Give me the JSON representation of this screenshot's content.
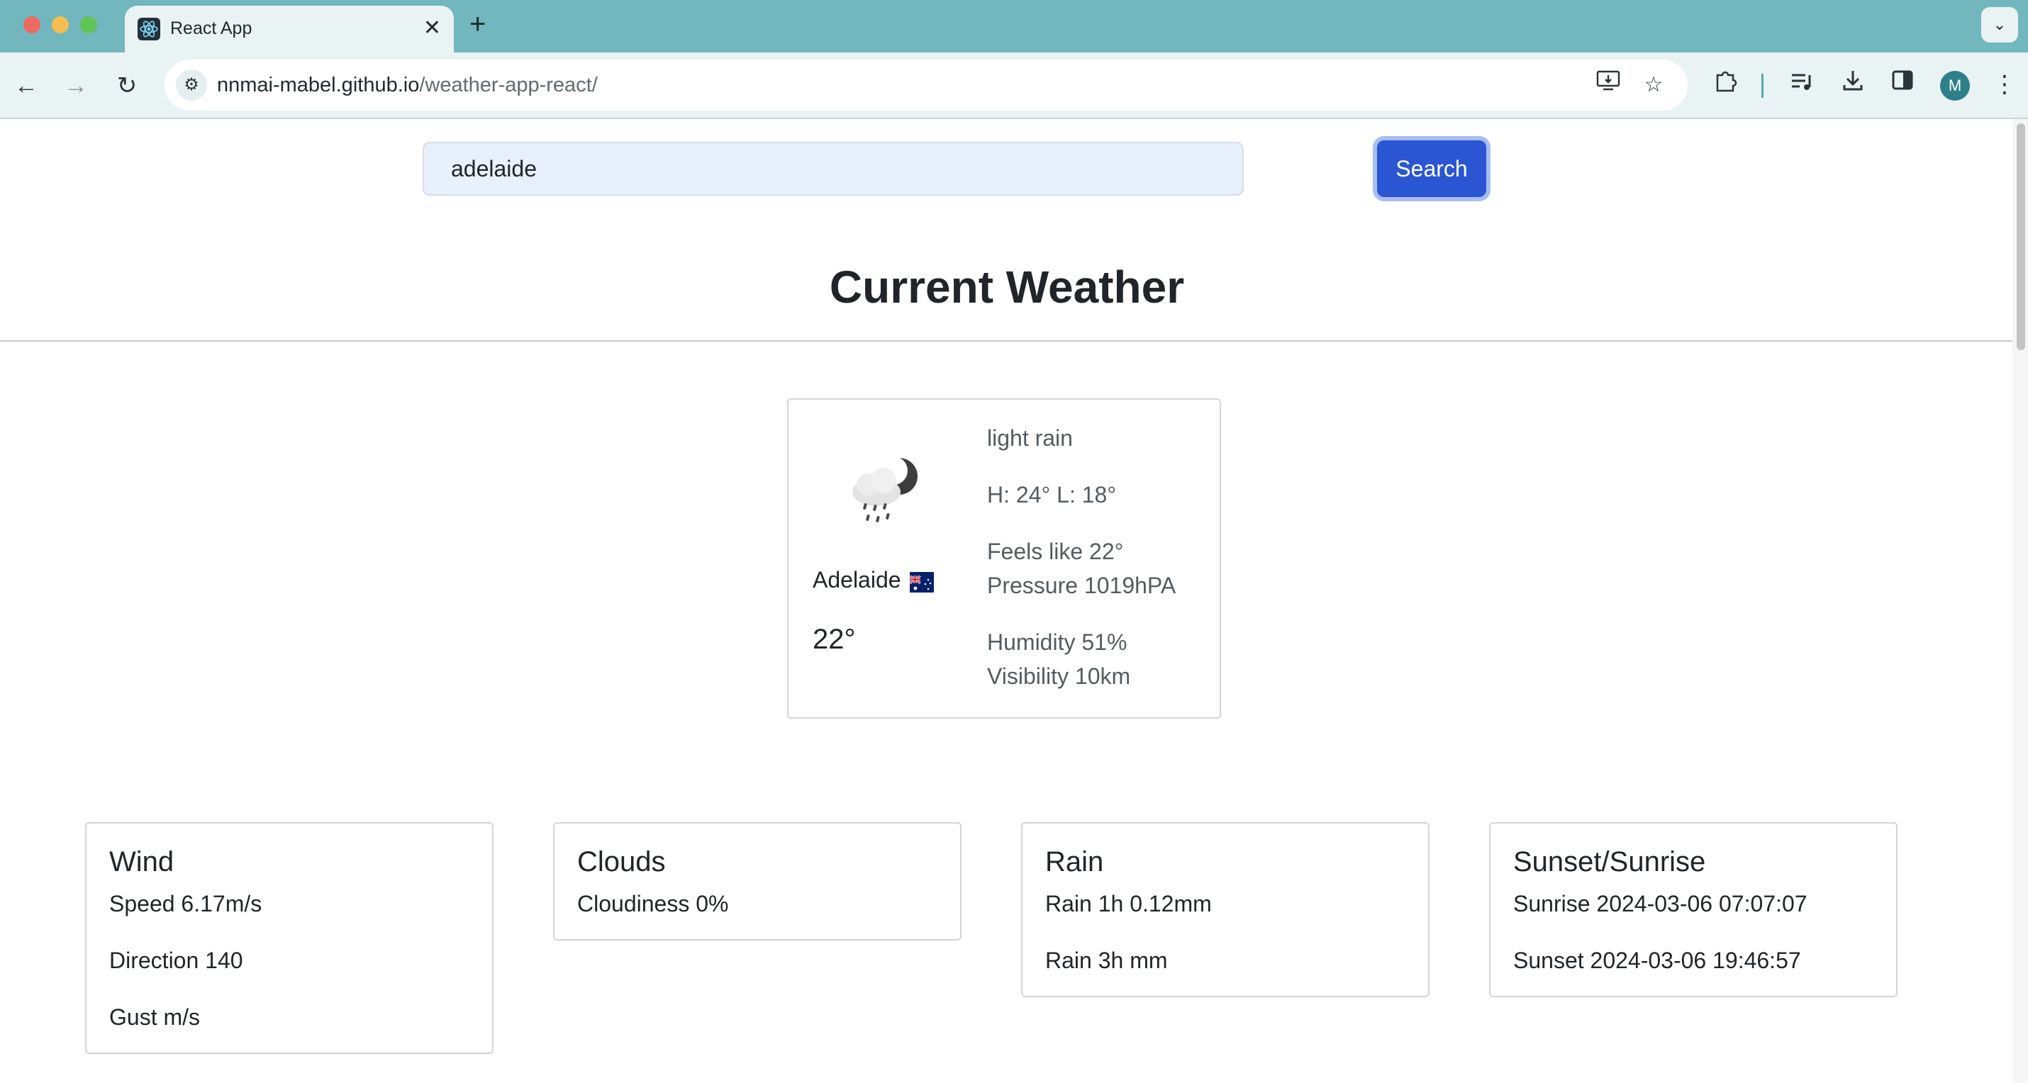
{
  "browser": {
    "tab_title": "React App",
    "url_host": "nnmai-mabel.github.io",
    "url_path": "/weather-app-react/",
    "profile_initial": "M"
  },
  "search": {
    "value": "adelaide",
    "button_label": "Search"
  },
  "page": {
    "title": "Current Weather"
  },
  "current": {
    "icon": "cloud-rain-moon-icon",
    "city": "Adelaide",
    "flag": "australia-flag-icon",
    "temp": "22°",
    "description": "light rain",
    "high_low": "H: 24° L: 18°",
    "feels_like": "Feels like 22°",
    "pressure": "Pressure 1019hPA",
    "humidity": "Humidity 51%",
    "visibility": "Visibility 10km"
  },
  "cards": {
    "wind": {
      "title": "Wind",
      "speed": "Speed 6.17m/s",
      "direction": "Direction 140",
      "gust": "Gust m/s"
    },
    "clouds": {
      "title": "Clouds",
      "cloudiness": "Cloudiness 0%"
    },
    "rain": {
      "title": "Rain",
      "rain_1h": "Rain 1h 0.12mm",
      "rain_3h": "Rain 3h mm"
    },
    "sun": {
      "title": "Sunset/Sunrise",
      "sunrise": "Sunrise 2024-03-06 07:07:07",
      "sunset": "Sunset 2024-03-06 19:46:57"
    }
  },
  "colors": {
    "tabbar": "#72b6be",
    "toolbar": "#e9f3f4",
    "search_button": "#2a55d3",
    "input_bg": "#e8f0fe"
  }
}
